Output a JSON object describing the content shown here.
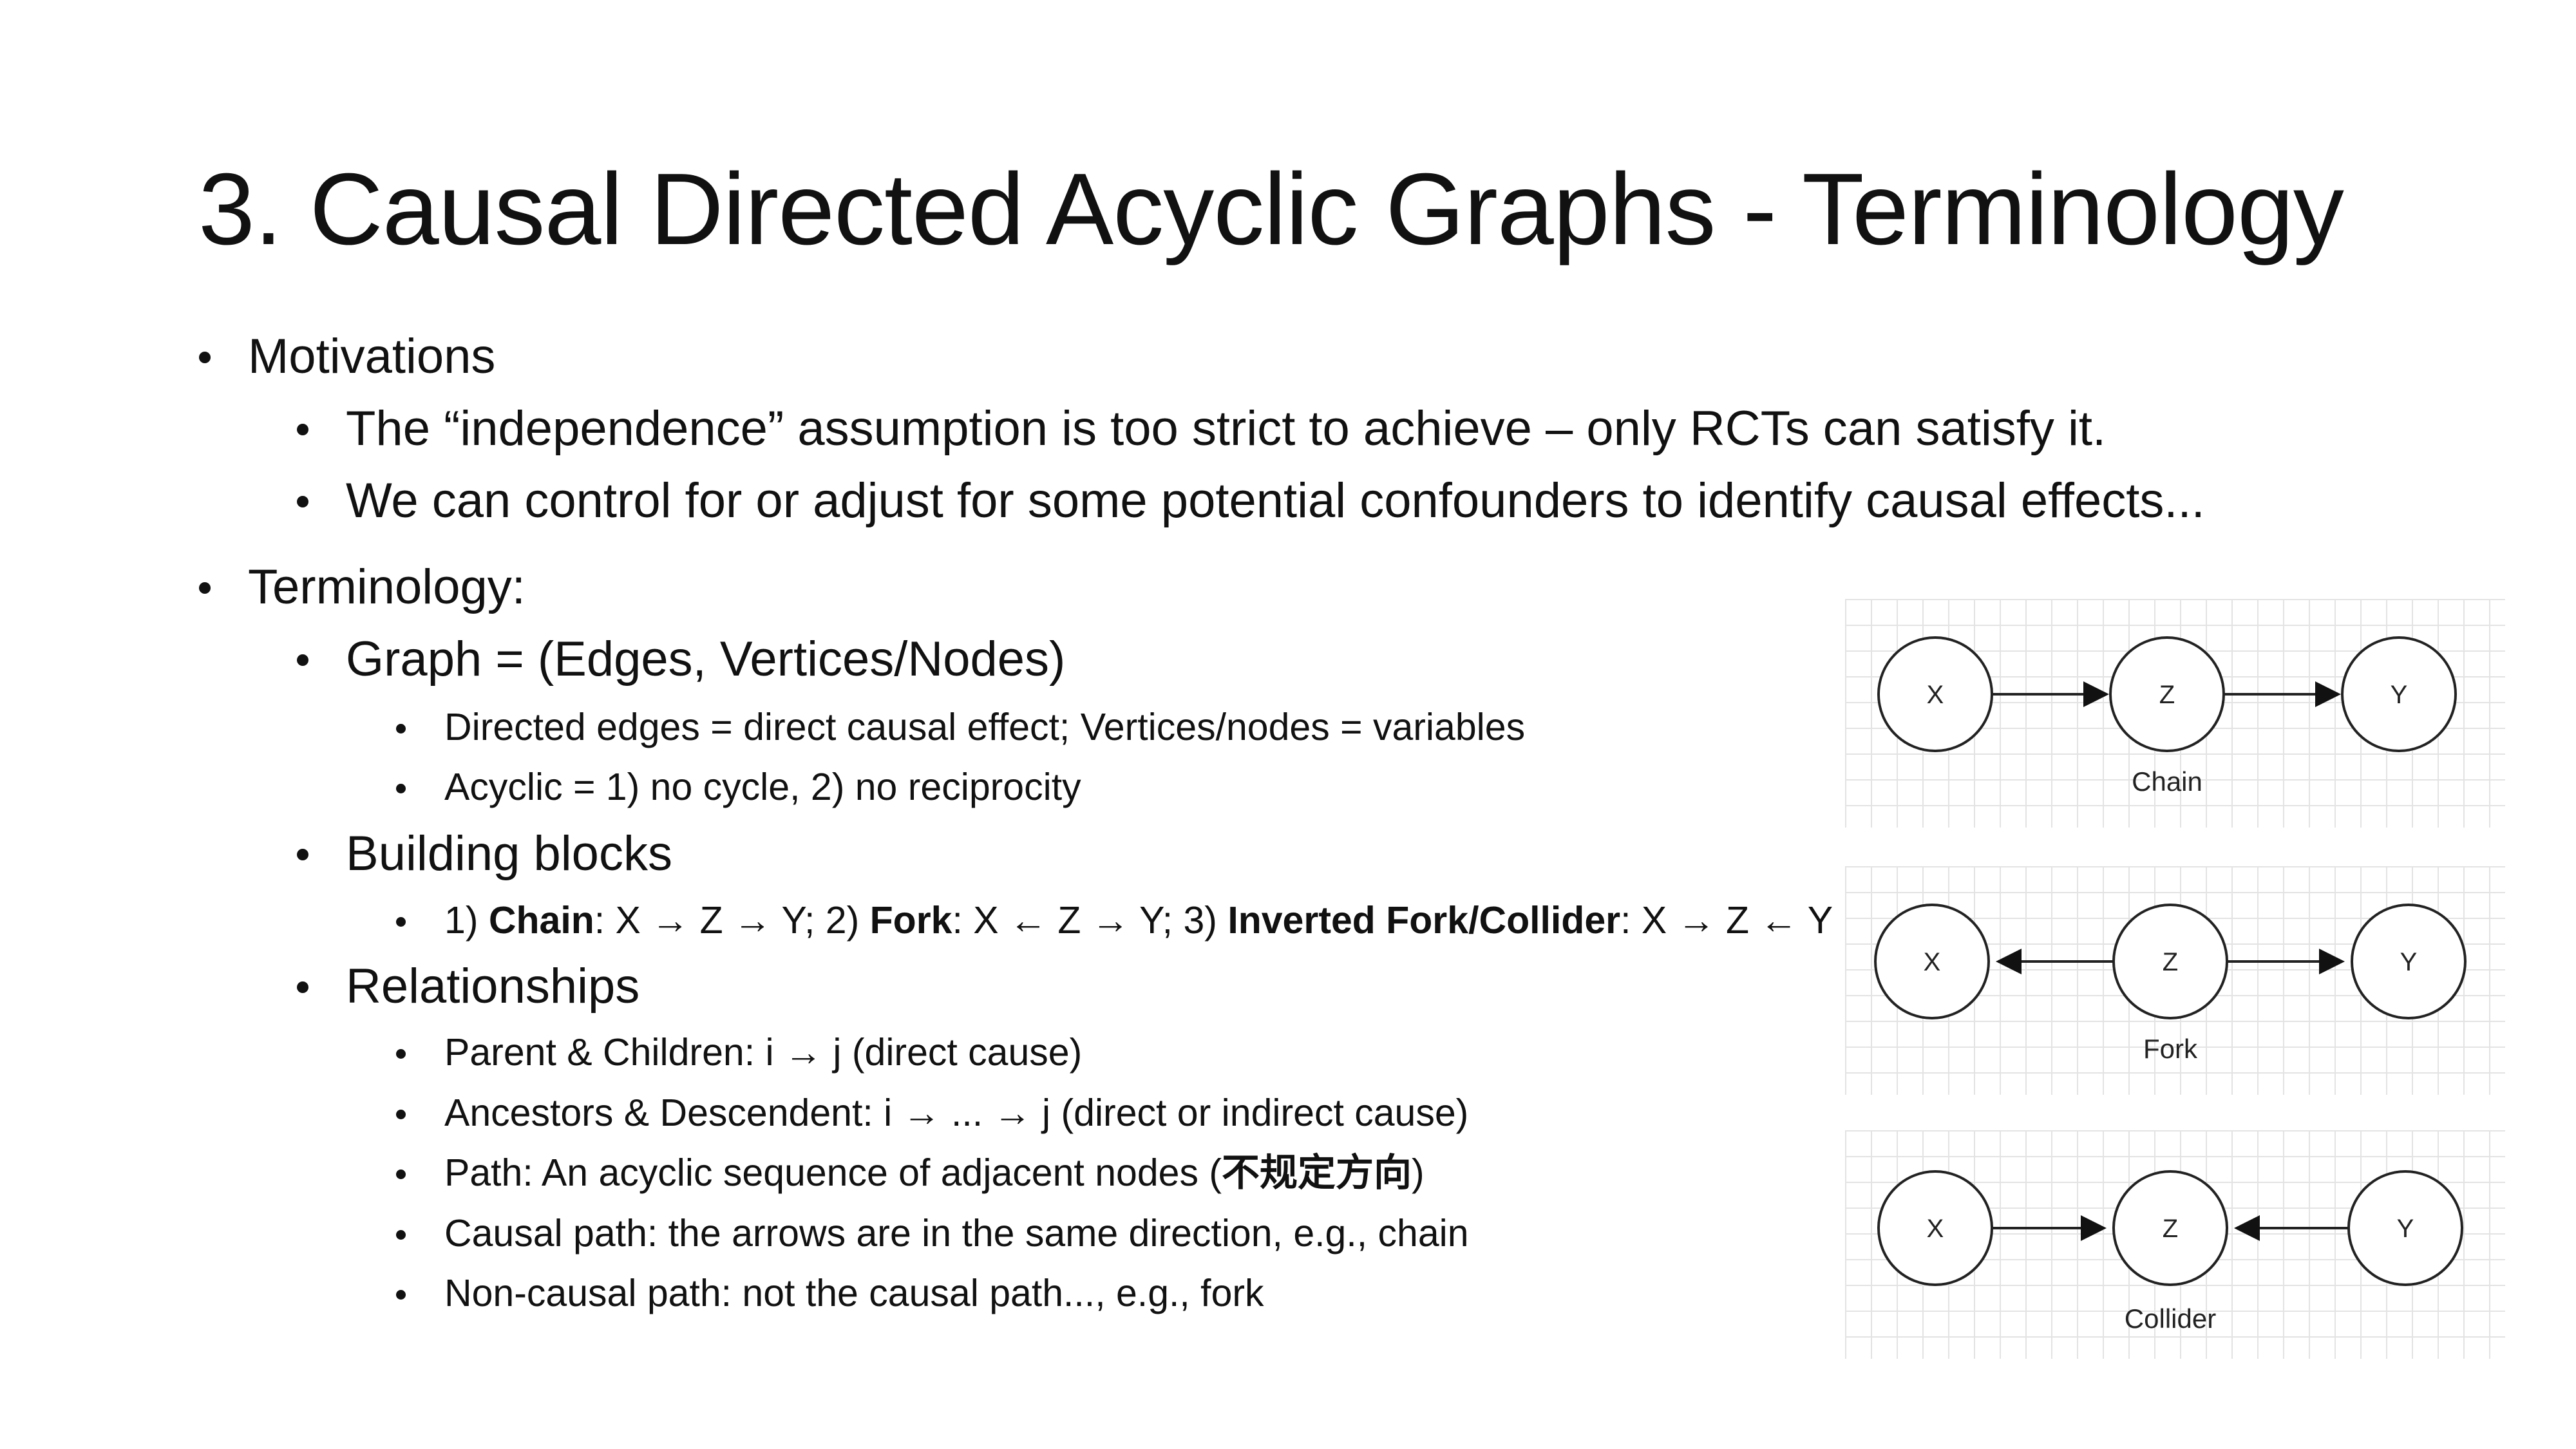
{
  "slide": {
    "title": "3. Causal Directed Acyclic Graphs - Terminology",
    "motivations": {
      "label": "Motivations",
      "items": [
        "The “independence” assumption is too strict to achieve – only RCTs can satisfy it.",
        "We can control for or adjust for some potential confounders to identify causal effects..."
      ]
    },
    "terminology": {
      "label": "Terminology:",
      "graph": {
        "label": "Graph = (Edges, Vertices/Nodes)",
        "items": [
          "Directed edges = direct causal effect; Vertices/nodes = variables",
          "Acyclic = 1) no cycle, 2) no reciprocity"
        ]
      },
      "building_blocks": {
        "label": "Building blocks",
        "item": {
          "p1": "1) ",
          "chain": "Chain",
          "p2": ": X → Z → Y; 2) ",
          "fork": "Fork",
          "p3": ": X ← Z → Y; 3) ",
          "collider": "Inverted Fork/Collider",
          "p4": ": X → Z ← Y"
        }
      },
      "relationships": {
        "label": "Relationships",
        "items": [
          "Parent & Children: i → j (direct cause)",
          "Ancestors & Descendent: i → ... → j (direct or indirect cause)",
          "Causal path: the arrows are in the same direction, e.g., chain",
          "Non-causal path: not the causal path..., e.g., fork"
        ],
        "path_item": {
          "prefix": "Path: An acyclic sequence of adjacent nodes (",
          "cjk": "不规定方向",
          "suffix": ")"
        }
      }
    }
  },
  "diagrams": {
    "chain": {
      "x": "X",
      "z": "Z",
      "y": "Y",
      "caption": "Chain"
    },
    "fork": {
      "x": "X",
      "z": "Z",
      "y": "Y",
      "caption": "Fork"
    },
    "collider": {
      "x": "X",
      "z": "Z",
      "y": "Y",
      "caption": "Collider"
    }
  }
}
